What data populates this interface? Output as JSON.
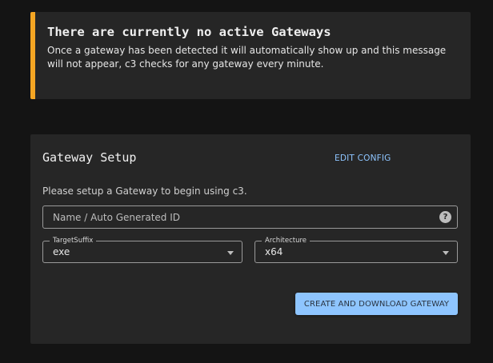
{
  "alert": {
    "title": "There are currently no active Gateways",
    "message": "Once a gateway has been detected it will automatically show up and this message will not appear, c3 checks for any gateway every minute.",
    "accent_color": "#f5a623"
  },
  "gateway_setup": {
    "title": "Gateway Setup",
    "edit_config_label": "EDIT CONFIG",
    "subtitle": "Please setup a Gateway to begin using c3.",
    "name_field": {
      "placeholder": "Name / Auto Generated ID",
      "value": "",
      "help_icon": "help-circle-icon",
      "help_glyph": "?"
    },
    "target_suffix": {
      "label": "TargetSuffix",
      "value": "exe"
    },
    "architecture": {
      "label": "Architecture",
      "value": "x64"
    },
    "create_button_label": "CREATE AND DOWNLOAD GATEWAY",
    "button_color": "#8ec5ff"
  }
}
